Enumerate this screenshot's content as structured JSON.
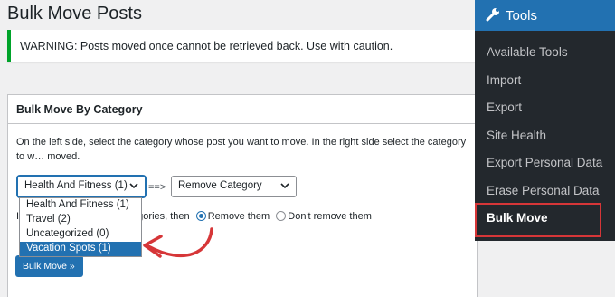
{
  "page": {
    "title": "Bulk Move Posts"
  },
  "notice": {
    "text": "WARNING: Posts moved once cannot be retrieved back. Use with caution."
  },
  "box": {
    "title": "Bulk Move By Category",
    "description": "On the left side, select the category whose post you want to move. In the right side select the category to w… moved.",
    "from_select_value": "Health And Fitness  (1)",
    "arrow_text": "==>",
    "to_select_value": "Remove Category",
    "options_prefix": "I",
    "options_mid": "egories, then",
    "radio_remove_label": "Remove them",
    "radio_keep_label": "Don't remove them",
    "button_label": "Bulk Move »"
  },
  "dropdown": {
    "options": [
      {
        "label": "Health And Fitness  (1)",
        "selected": false
      },
      {
        "label": "Travel  (2)",
        "selected": false
      },
      {
        "label": "Uncategorized  (0)",
        "selected": false
      },
      {
        "label": "Vacation Spots  (1)",
        "selected": true
      }
    ]
  },
  "menu": {
    "header": "Tools",
    "header_icon": "wrench-icon",
    "items": [
      {
        "label": "Available Tools",
        "current": false
      },
      {
        "label": "Import",
        "current": false
      },
      {
        "label": "Export",
        "current": false
      },
      {
        "label": "Site Health",
        "current": false
      },
      {
        "label": "Export Personal Data",
        "current": false
      },
      {
        "label": "Erase Personal Data",
        "current": false
      },
      {
        "label": "Bulk Move",
        "current": true
      }
    ]
  },
  "colors": {
    "accent": "#2271b1",
    "annotation": "#d63638",
    "menu_bg": "#23282d",
    "notice_border": "#00a32a"
  }
}
